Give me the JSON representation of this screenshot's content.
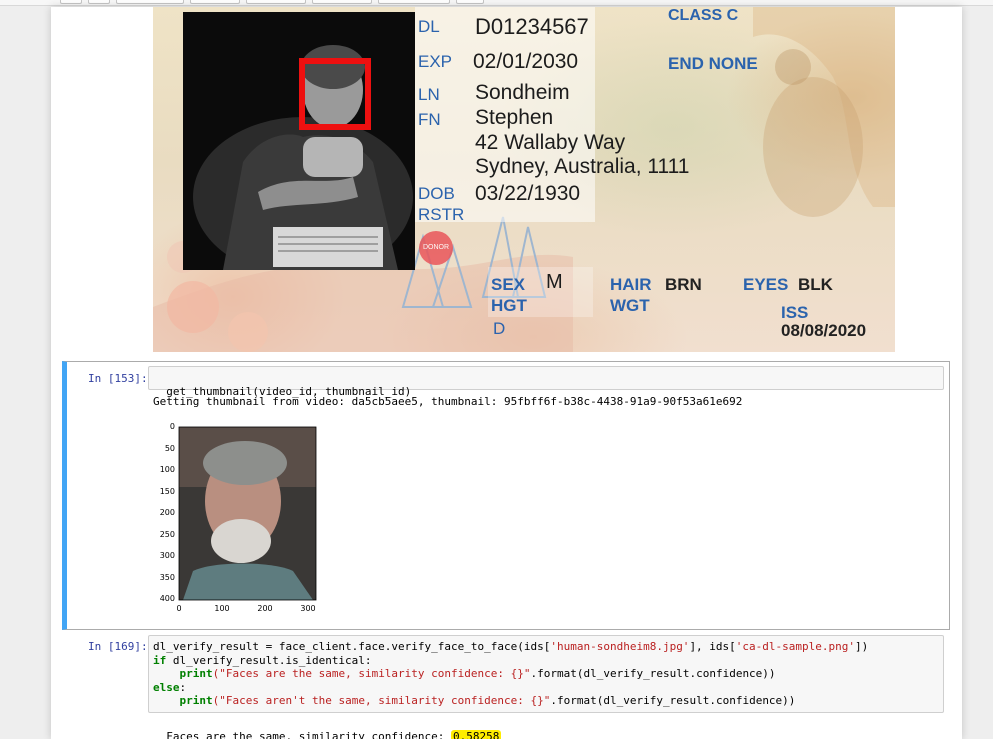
{
  "license": {
    "dl_label": "DL",
    "dl_number": "D01234567",
    "class_label": "CLASS C",
    "exp_label": "EXP",
    "exp_date": "02/01/2030",
    "end_label": "END NONE",
    "ln_label": "LN",
    "last_name": "Sondheim",
    "fn_label": "FN",
    "first_name": "Stephen",
    "address_line1": "42 Wallaby Way",
    "address_line2": "Sydney, Australia, 1111",
    "dob_label": "DOB",
    "dob": "03/22/1930",
    "rstr_label": "RSTR",
    "donor_label": "DONOR",
    "sex_label": "SEX",
    "sex_value": "M",
    "hgt_label": "HGT",
    "hair_label": "HAIR",
    "hair_value": "BRN",
    "wgt_label": "WGT",
    "eyes_label": "EYES",
    "eyes_value": "BLK",
    "iss_label": "ISS",
    "iss_date": "08/08/2020",
    "d_label": "D"
  },
  "cell_153": {
    "prompt": "In [153]:",
    "code": "get_thumbnail(video_id, thumbnail_id)",
    "output": "Getting thumbnail from video: da5cb5aee5, thumbnail: 95fbff6f-b38c-4438-91a9-90f53a61e692",
    "plot": {
      "y_ticks": [
        "0",
        "50",
        "100",
        "150",
        "200",
        "250",
        "300",
        "350",
        "400"
      ],
      "x_ticks": [
        "0",
        "100",
        "200",
        "300"
      ]
    }
  },
  "cell_169": {
    "prompt": "In [169]:",
    "code_line1_a": "dl_verify_result = face_client.face.verify_face_to_face(ids[",
    "code_line1_s1": "'human-sondheim8.jpg'",
    "code_line1_b": "], ids[",
    "code_line1_s2": "'ca-dl-sample.png'",
    "code_line1_c": "])",
    "code_line2_kw": "if",
    "code_line2_rest": " dl_verify_result.is_identical:",
    "code_line3_indent": "    ",
    "code_line3_kw": "print",
    "code_line3_s": "(\"Faces are the same, similarity confidence: {}\"",
    "code_line3_rest": ".format(dl_verify_result.confidence))",
    "code_line4_kw": "else",
    "code_line4_rest": ":",
    "code_line5_indent": "    ",
    "code_line5_kw": "print",
    "code_line5_s": "(\"Faces aren't the same, similarity confidence: {}\"",
    "code_line5_rest": ".format(dl_verify_result.confidence))",
    "output_prefix": "Faces are the same, similarity confidence: ",
    "output_value": "0.58258"
  },
  "colors": {
    "selected_cell_accent": "#42a5f5",
    "face_box": "#ee1010",
    "highlight": "#ffed00"
  }
}
